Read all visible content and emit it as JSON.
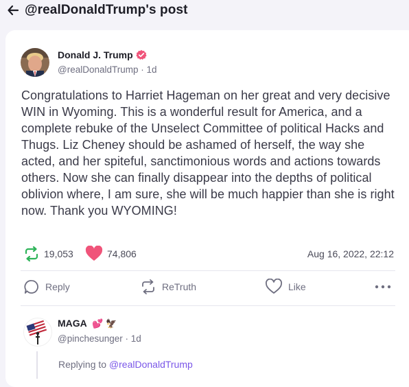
{
  "header": {
    "title": "@realDonaldTrump's post"
  },
  "post": {
    "author_name": "Donald J. Trump",
    "handle": "@realDonaldTrump",
    "separator": " · ",
    "age": "1d",
    "text": "Congratulations to Harriet Hageman on her great and very decisive WIN in Wyoming. This is a wonderful result for America, and a complete rebuke of the Unselect Committee of political Hacks and Thugs. Liz Cheney should be ashamed of herself, the way she acted, and her spiteful, sanctimonious words and actions towards others. Now she can finally disappear into the depths of political oblivion where, I am sure, she will be much happier than she is right now. Thank you WYOMING!",
    "retruth_count": "19,053",
    "like_count": "74,806",
    "timestamp": "Aug 16, 2022, 22:12"
  },
  "actions": {
    "reply_label": "Reply",
    "retruth_label": "ReTruth",
    "like_label": "Like"
  },
  "reply": {
    "author_name": "MAGA",
    "name_emojis": "💕 🦅",
    "handle": "@pinchesunger",
    "separator": " · ",
    "age": "1d",
    "replying_prefix": "Replying to ",
    "replying_mention": "@realDonaldTrump"
  },
  "colors": {
    "accent": "#7a56e8",
    "retruth_green": "#2fb45a",
    "like_pink": "#f0547a",
    "background": "#f4f3f9"
  },
  "icons": {
    "back": "arrow-left-icon",
    "verified": "verified-badge-icon",
    "retruth": "retruth-icon",
    "like": "heart-icon",
    "reply": "reply-bubble-icon",
    "more": "more-dots-icon"
  }
}
